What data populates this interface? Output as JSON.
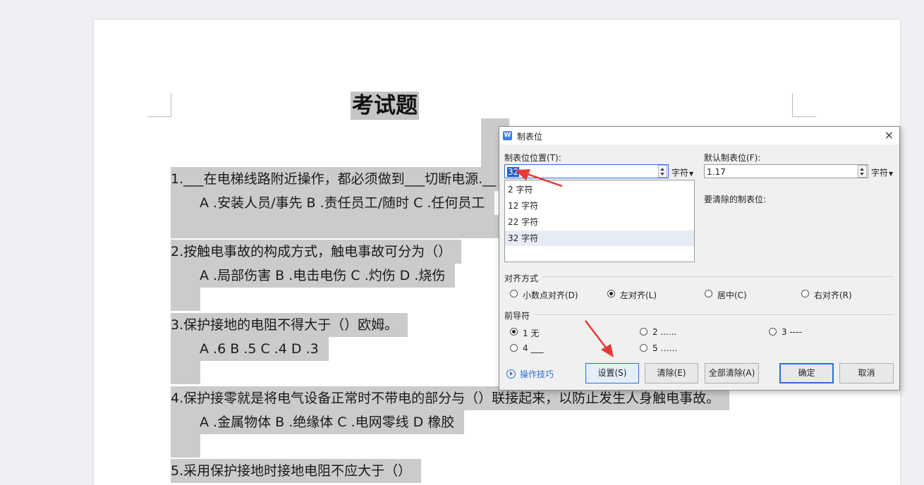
{
  "document": {
    "title": "考试题",
    "questions": [
      {
        "stem": "1.___在电梯线路附近操作，都必须做到___切断电源.__",
        "options": "A .安装人员/事先  B .责任员工/随时  C .任何员工"
      },
      {
        "stem": "2.按触电事故的构成方式，触电事故可分为（）",
        "options": "A .局部伤害   B .电击电伤   C .灼伤   D .烧伤"
      },
      {
        "stem": "3.保护接地的电阻不得大于（）欧姆。",
        "options": "A .6 B .5 C .4 D .3"
      },
      {
        "stem": "4.保护接零就是将电气设备正常时不带电的部分与（）联接起来，以防止发生人身触电事故。",
        "options": "A .金属物体   B .绝缘体       C .电网零线   D  橡胶"
      },
      {
        "stem": "5.采用保护接地时接地电阻不应大于（）"
      }
    ]
  },
  "dialog": {
    "title": "制表位",
    "app_icon": "W",
    "close_icon": "×",
    "tab_position_label": "制表位位置(T):",
    "tab_position_value": "32",
    "unit_label": "字符",
    "tab_list": [
      "2 字符",
      "12 字符",
      "22 字符",
      "32 字符"
    ],
    "default_tab_label": "默认制表位(F):",
    "default_tab_value": "1.17",
    "to_clear_label": "要清除的制表位:",
    "alignment_label": "对齐方式",
    "alignment_options": [
      "小数点对齐(D)",
      "左对齐(L)",
      "居中(C)",
      "右对齐(R)"
    ],
    "alignment_selected": "左对齐(L)",
    "leader_label": "前导符",
    "leader_options": [
      "1 无",
      "2 ......",
      "3 ----",
      "4 ___",
      "5 ……"
    ],
    "leader_selected": "1 无",
    "tips_label": "操作技巧",
    "buttons": {
      "set": "设置(S)",
      "clear": "清除(E)",
      "clear_all": "全部清除(A)",
      "ok": "确定",
      "cancel": "取消"
    }
  },
  "colors": {
    "selection": "#cbcbcb",
    "accent": "#2a6fd6",
    "arrow": "#e53935"
  }
}
